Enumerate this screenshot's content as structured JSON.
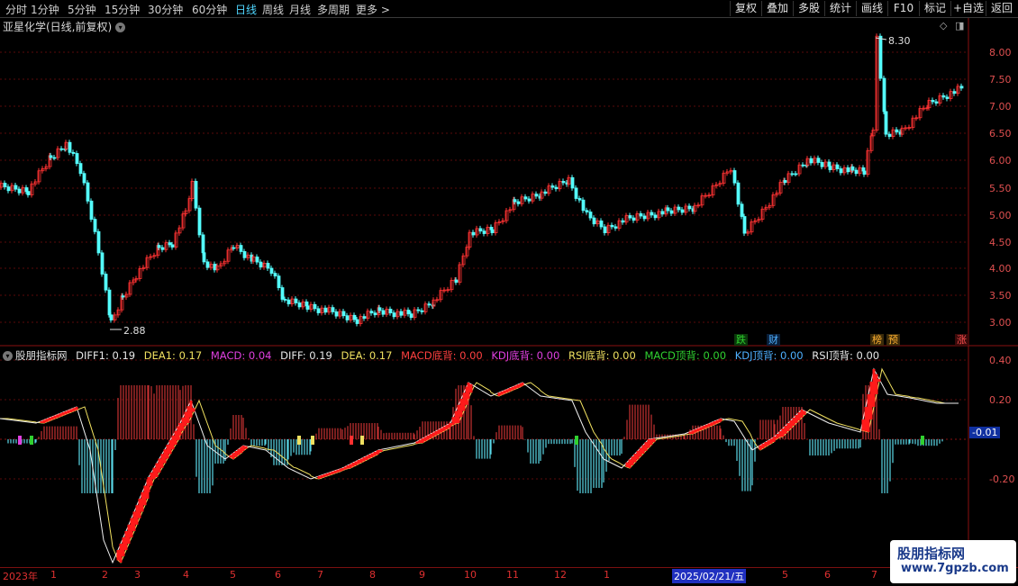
{
  "toolbar": {
    "periods": [
      "分时",
      "1分钟",
      "5分钟",
      "15分钟",
      "30分钟",
      "60分钟",
      "日线",
      "周线",
      "月线",
      "多周期",
      "更多 >"
    ],
    "active_period": "日线",
    "right_buttons": [
      "复权",
      "叠加",
      "多股",
      "统计",
      "画线",
      "F10",
      "标记",
      "+自选",
      "返回"
    ]
  },
  "main_chart": {
    "title": "亚星化学(日线,前复权)",
    "high_label": "8.30",
    "low_label": "2.88",
    "y_ticks": [
      "8.00",
      "7.50",
      "7.00",
      "6.50",
      "6.00",
      "5.50",
      "5.00",
      "4.50",
      "4.00",
      "3.50",
      "3.00"
    ],
    "badges": [
      {
        "text": "跌",
        "color": "#30d030"
      },
      {
        "text": "财",
        "color": "#4fb0ff"
      },
      {
        "text": "榜",
        "color": "#ffb030"
      },
      {
        "text": "预",
        "color": "#ffb030"
      },
      {
        "text": "涨",
        "color": "#ff5050"
      }
    ]
  },
  "indicator": {
    "name": "股朋指标网",
    "values": [
      {
        "label": "DIFF1: 0.19",
        "color": "#e8e8e8"
      },
      {
        "label": "DEA1: 0.17",
        "color": "#f0e060"
      },
      {
        "label": "MACD: 0.04",
        "color": "#e040e0"
      },
      {
        "label": "DIFF: 0.19",
        "color": "#e8e8e8"
      },
      {
        "label": "DEA: 0.17",
        "color": "#f0e060"
      },
      {
        "label": "MACD底背: 0.00",
        "color": "#ff4040"
      },
      {
        "label": "KDJ底背: 0.00",
        "color": "#e040e0"
      },
      {
        "label": "RSI底背: 0.00",
        "color": "#f0e060"
      },
      {
        "label": "MACD顶背: 0.00",
        "color": "#30d030"
      },
      {
        "label": "KDJ顶背: 0.00",
        "color": "#4fb0ff"
      },
      {
        "label": "RSI顶背: 0.00",
        "color": "#e8e8e8"
      }
    ],
    "y_ticks": [
      "0.40",
      "0.20",
      "-0.01",
      "-0.20"
    ],
    "current_marker": "-0.01"
  },
  "time_axis": {
    "labels": [
      "2023年",
      "1",
      "2",
      "3",
      "4",
      "5",
      "6",
      "7",
      "8",
      "9",
      "10",
      "11",
      "12",
      "1",
      "2025/02/21/五",
      "5",
      "6",
      "7"
    ],
    "highlight": "2025/02/21/五"
  },
  "watermark": {
    "line1": "股朋指标网",
    "line2": "www.7gpzb.com"
  },
  "colors": {
    "up": "#ff3232",
    "down": "#54ffff",
    "grid": "#7a1010",
    "active": "#4fd6ff"
  }
}
